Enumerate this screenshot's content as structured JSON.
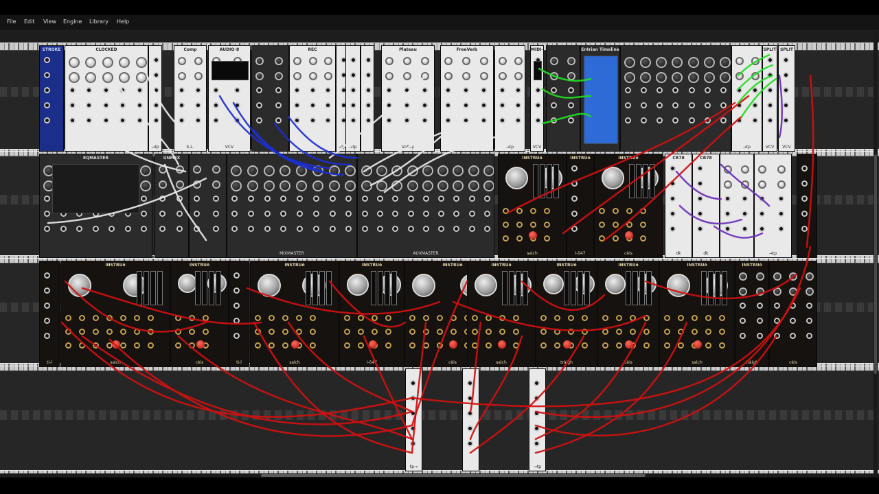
{
  "menu": {
    "items": [
      "File",
      "Edit",
      "View",
      "Engine",
      "Library",
      "Help"
    ]
  },
  "modules": {
    "row1": [
      {
        "name": "STROKE",
        "style": "blue"
      },
      {
        "name": "CLOCKED",
        "style": "light"
      },
      {
        "name": "",
        "style": "light",
        "foot": "→tp"
      },
      {
        "name": "Comp",
        "style": "light",
        "foot": "S.L."
      },
      {
        "name": "AUDIO-8",
        "style": "light",
        "foot": "VCV"
      },
      {
        "name": "",
        "style": "dark",
        "foot": ""
      },
      {
        "name": "REC",
        "style": "light",
        "foot": ""
      },
      {
        "name": "",
        "style": "light",
        "foot": "→tp"
      },
      {
        "name": "",
        "style": "light",
        "foot": "→tp"
      },
      {
        "name": "",
        "style": "light",
        "foot": ""
      },
      {
        "name": "Plateau",
        "style": "light",
        "foot": "Valley"
      },
      {
        "name": "FreeVerb",
        "style": "light",
        "foot": ""
      },
      {
        "name": "",
        "style": "light",
        "foot": "→tp"
      },
      {
        "name": "MIDI-CV",
        "style": "light",
        "foot": "VCV"
      },
      {
        "name": "",
        "style": "dark",
        "foot": ""
      },
      {
        "name": "Entrian Timeline",
        "style": "dark",
        "foot": ""
      },
      {
        "name": "",
        "style": "dark",
        "foot": ""
      },
      {
        "name": "",
        "style": "light",
        "foot": "→tp"
      },
      {
        "name": "SPLIT",
        "style": "light",
        "foot": "VCV"
      },
      {
        "name": "SPLIT",
        "style": "light",
        "foot": "VCV"
      }
    ],
    "row2": [
      {
        "name": "EQMASTER",
        "style": "dark"
      },
      {
        "name": "UNMEX",
        "style": "dark"
      },
      {
        "name": "",
        "style": "dark"
      },
      {
        "name": "",
        "style": "dark",
        "foot": "MIXMASTER"
      },
      {
        "name": "",
        "style": "dark",
        "foot": "AUXMASTER"
      },
      {
        "name": "INSTRUō",
        "style": "black",
        "foot": "saìch"
      },
      {
        "name": "INSTRUō",
        "style": "black",
        "foot": "I-ō47"
      },
      {
        "name": "INSTRUō",
        "style": "black",
        "foot": "cèis"
      },
      {
        "name": "CR78",
        "style": "light",
        "foot": "dk"
      },
      {
        "name": "CR78",
        "style": "light",
        "foot": "dk"
      },
      {
        "name": "",
        "style": "light",
        "foot": ""
      },
      {
        "name": "",
        "style": "light",
        "foot": "→tp"
      },
      {
        "name": "",
        "style": "black",
        "foot": ""
      }
    ],
    "row3": [
      {
        "name": "",
        "style": "black",
        "foot": "ti-l"
      },
      {
        "name": "INSTRUō",
        "style": "black",
        "foot": "saìch"
      },
      {
        "name": "INSTRUō",
        "style": "black",
        "foot": "cèis"
      },
      {
        "name": "",
        "style": "black",
        "foot": "ti-l"
      },
      {
        "name": "INSTRUō",
        "style": "black",
        "foot": "saìch"
      },
      {
        "name": "INSTRUō",
        "style": "black",
        "foot": "I-ō47"
      },
      {
        "name": "INSTRUō",
        "style": "black",
        "foot": "cèis"
      },
      {
        "name": "INSTRUō",
        "style": "black",
        "foot": "saìch"
      },
      {
        "name": "INSTRUō",
        "style": "black",
        "foot": "tràigh"
      },
      {
        "name": "INSTRUō",
        "style": "black",
        "foot": "cèis"
      },
      {
        "name": "INSTRUō",
        "style": "black",
        "foot": "saìch"
      },
      {
        "name": "INSTRUō",
        "style": "black",
        "foot": "tràigh"
      },
      {
        "name": "",
        "style": "black",
        "foot": "cèis"
      }
    ],
    "row4": [
      {
        "name": "",
        "style": "light",
        "foot": "tp→"
      },
      {
        "name": "",
        "style": "light",
        "foot": ""
      },
      {
        "name": "",
        "style": "light",
        "foot": "→tp"
      }
    ]
  },
  "colors": {
    "cable_red": "#d01010",
    "cable_white": "#e8e8e8",
    "cable_blue": "#1c2fd0",
    "cable_green": "#22dd22",
    "cable_purple": "#6a2fb8",
    "rack_bg": "#1d1d1d"
  }
}
